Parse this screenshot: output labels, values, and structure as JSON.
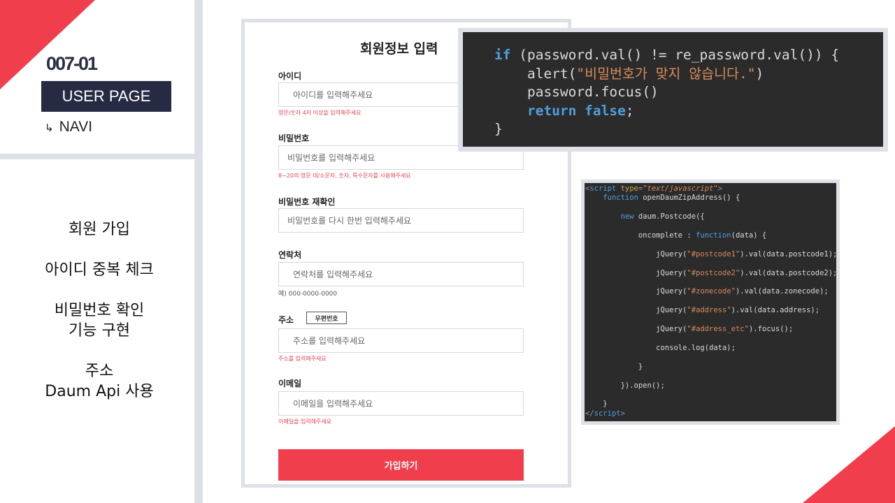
{
  "slide": {
    "number": "007-01",
    "section_label": "USER PAGE",
    "nav_arrow": "↳",
    "nav_label": "NAVI",
    "features": [
      "회원 가입",
      "아이디 중복 체크",
      "비밀번호 확인\n기능 구현",
      "주소\nDaum Api 사용"
    ]
  },
  "form": {
    "title": "회원정보 입력",
    "fields": {
      "id": {
        "label": "아이디",
        "placeholder": "아이디를 입력해주세요",
        "hint": "영문/숫자 4자 이상을 입력해주세요"
      },
      "password": {
        "label": "비밀번호",
        "placeholder": "비밀번호를 입력해주세요",
        "hint": "8~20의 영문 대/소문자, 숫자, 특수문자를 사용해주세요"
      },
      "password_confirm": {
        "label": "비밀번호 재확인",
        "placeholder": "비밀번호를 다시 한번 입력해주세요"
      },
      "phone": {
        "label": "연락처",
        "placeholder": "연락처를 입력해주세요",
        "hint": "예) 000-0000-0000"
      },
      "address": {
        "label": "주소",
        "zip_button": "우편번호",
        "placeholder": "주소를 입력해주세요",
        "hint": "주소를 입력해주세요"
      },
      "email": {
        "label": "이메일",
        "placeholder": "이메일을 입력해주세요",
        "hint": "이메일을 입력해주세요"
      }
    },
    "submit_label": "가입하기"
  },
  "code_big": {
    "line1_kw": "if",
    "line1_rest": " (password.val() != re_password.val()) {",
    "line2_pre": "    alert(",
    "line2_str": "\"비밀번호가 맞지 않습니다.\"",
    "line2_post": ")",
    "line3": "    password.focus()",
    "line4_kw": "return false",
    "line4_post": ";",
    "line5": "}"
  },
  "code_small": {
    "script_open_tag": "script",
    "script_attr": "type",
    "script_attr_value": "\"text/javascript\"",
    "func_kw": "function",
    "func_sig": " openDaumZipAddress() {",
    "new_kw": "new",
    "new_rest": " daum.Postcode({",
    "oncomplete": "oncomplete : ",
    "oncomplete_kw": "function",
    "oncomplete_rest": "(data) {",
    "lines": [
      {
        "pre": "jQuery(",
        "str": "\"#postcode1\"",
        "post": ").val(data.postcode1);"
      },
      {
        "pre": "jQuery(",
        "str": "\"#postcode2\"",
        "post": ").val(data.postcode2);"
      },
      {
        "pre": "jQuery(",
        "str": "\"#zonecode\"",
        "post": ").val(data.zonecode);"
      },
      {
        "pre": "jQuery(",
        "str": "\"#address\"",
        "post": ").val(data.address);"
      },
      {
        "pre": "jQuery(",
        "str": "\"#address_etc\"",
        "post": ").focus();"
      }
    ],
    "console_line": "console.log(data);",
    "close_inner": "}",
    "close_open": "}).open();",
    "close_func": "}",
    "script_close_tag": "script"
  }
}
